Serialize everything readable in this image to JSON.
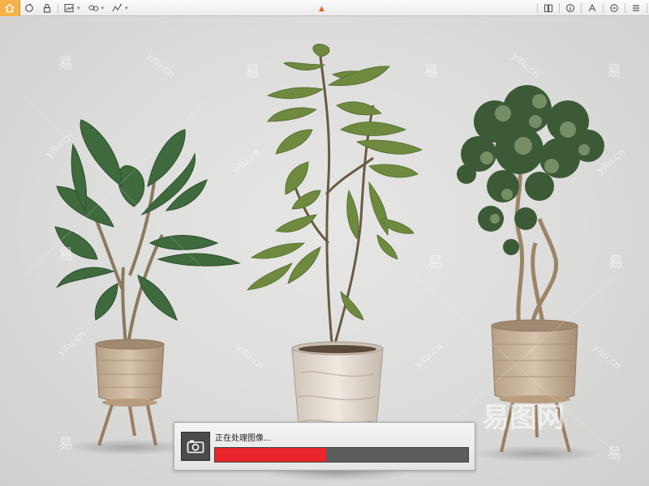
{
  "toolbar": {
    "left_tools": [
      {
        "name": "home",
        "icon": "home-icon"
      },
      {
        "name": "rotate",
        "icon": "rotate-icon"
      },
      {
        "name": "lock",
        "icon": "lock-icon"
      },
      {
        "name": "image-tools",
        "icon": "image-tools-icon"
      },
      {
        "name": "link-tools",
        "icon": "link-tools-icon"
      },
      {
        "name": "measure-tools",
        "icon": "measure-tools-icon"
      }
    ],
    "right_tools": [
      {
        "name": "book",
        "icon": "book-icon"
      },
      {
        "name": "info",
        "icon": "info-icon"
      },
      {
        "name": "text",
        "icon": "text-icon"
      },
      {
        "name": "settings",
        "icon": "settings-icon"
      },
      {
        "name": "menu",
        "icon": "menu-icon"
      }
    ],
    "center_toggle_icon": "caret-up-icon",
    "accent_color": "#f6b24a"
  },
  "scene": {
    "subject": "three potted plants",
    "background_color": "#dcdcdb"
  },
  "watermark": {
    "glyph": "易",
    "domain": "yitu.cn",
    "logo_text": "易图网"
  },
  "progress_dialog": {
    "message": "正在处理图像...",
    "icon": "camera-icon",
    "progress_fraction": 0.44,
    "fill_color": "#e8262c",
    "track_color": "#5c5c5c"
  }
}
